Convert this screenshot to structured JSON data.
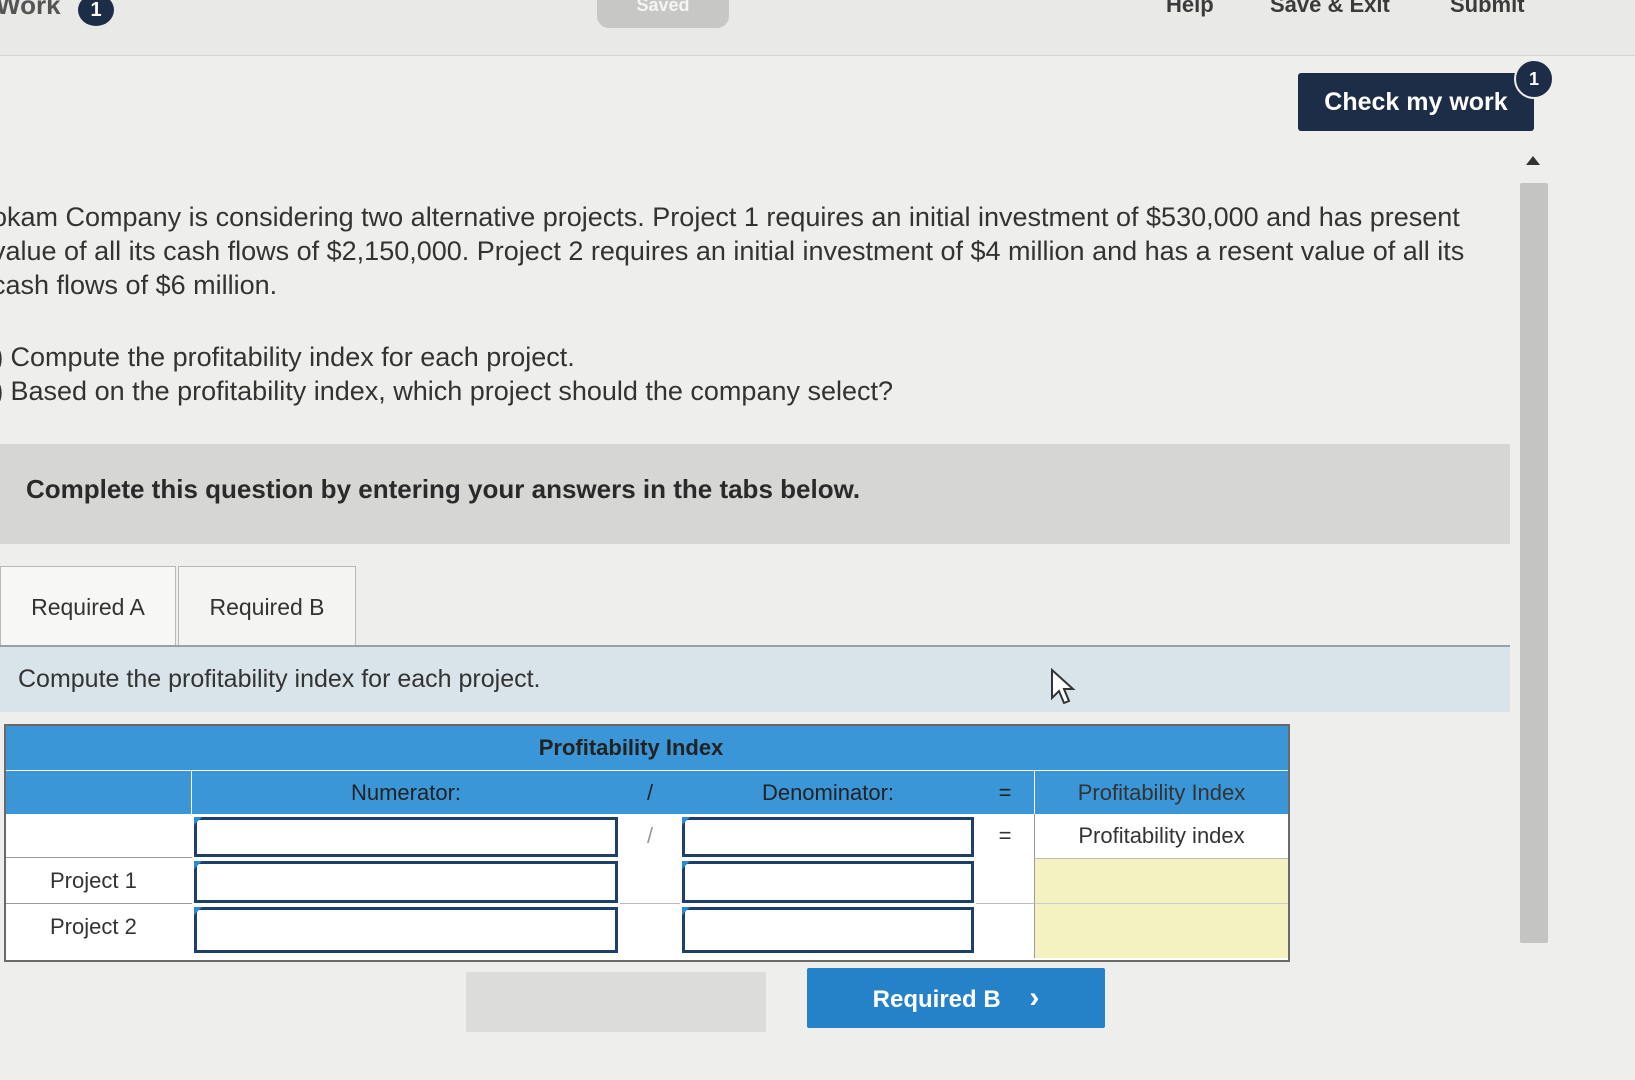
{
  "topbar": {
    "work_label": "Work",
    "work_badge": "1",
    "saved": "Saved",
    "help": "Help",
    "save_exit": "Save & Exit",
    "submit": "Submit"
  },
  "check_work": {
    "label": "Check my work",
    "badge": "1"
  },
  "question": {
    "text": "okam Company is considering two alternative projects. Project 1 requires an initial investment of $530,000 and has present value of all its cash flows of $2,150,000. Project 2 requires an initial investment of $4 million and has a resent value of all its cash flows of $6 million.",
    "req_a_marker": ")",
    "req_a": "Compute the profitability index for each project.",
    "req_b_marker": ")",
    "req_b": "Based on the profitability index, which project should the company select?"
  },
  "instruction": "Complete this question by entering your answers in the tabs below.",
  "tabs": [
    {
      "label": "Required A",
      "active": true
    },
    {
      "label": "Required B",
      "active": false
    }
  ],
  "content_heading": "Compute the profitability index for each project.",
  "table": {
    "title": "Profitability Index",
    "numerator": "Numerator:",
    "divide": "/",
    "denominator": "Denominator:",
    "equals": "=",
    "result_header": "Profitability Index",
    "result_sub": "Profitability index",
    "rows": [
      {
        "label": "Project 1",
        "numerator": "",
        "denominator": ""
      },
      {
        "label": "Project 2",
        "numerator": "",
        "denominator": ""
      }
    ]
  },
  "next_button": {
    "label": "Required B",
    "chevron": "›"
  }
}
